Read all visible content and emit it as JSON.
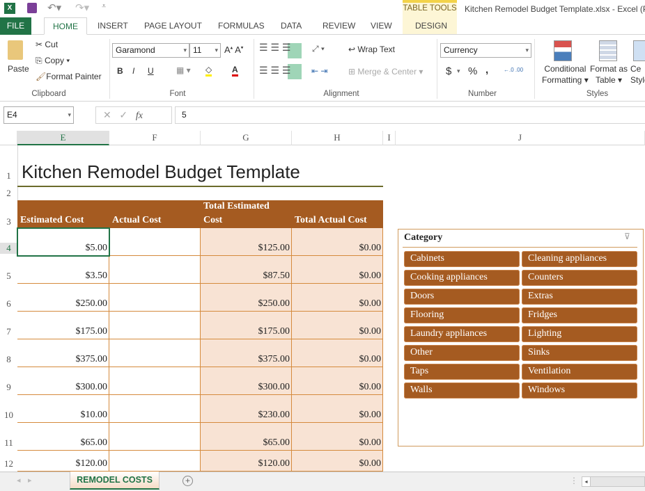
{
  "window": {
    "title": "Kitchen Remodel Budget Template.xlsx - Excel (Pr",
    "contextual_group": "TABLE TOOLS"
  },
  "tabs": [
    "FILE",
    "HOME",
    "INSERT",
    "PAGE LAYOUT",
    "FORMULAS",
    "DATA",
    "REVIEW",
    "VIEW",
    "DESIGN"
  ],
  "ribbon": {
    "clipboard": {
      "paste": "Paste",
      "cut": "Cut",
      "copy": "Copy",
      "format_painter": "Format Painter",
      "label": "Clipboard"
    },
    "font": {
      "name": "Garamond",
      "size": "11",
      "bold": "B",
      "italic": "I",
      "underline": "U",
      "label": "Font"
    },
    "alignment": {
      "wrap": "Wrap Text",
      "merge": "Merge & Center",
      "label": "Alignment"
    },
    "number": {
      "format": "Currency",
      "dollar": "$",
      "percent": "%",
      "comma": ",",
      "label": "Number"
    },
    "styles": {
      "conditional": "Conditional",
      "conditional2": "Formatting",
      "format_table": "Format as",
      "format_table2": "Table",
      "cell_styles": "Ce",
      "cell_styles2": "Style",
      "label": "Styles"
    }
  },
  "formula_bar": {
    "name_box": "E4",
    "fx": "fx",
    "value": "5"
  },
  "columns": [
    "E",
    "F",
    "G",
    "H",
    "I",
    "J"
  ],
  "sheet": {
    "title": "Kitchen Remodel Budget Template",
    "headers": [
      "Estimated Cost",
      "Actual Cost",
      "Total Estimated Cost",
      "Total Actual Cost"
    ],
    "rows": [
      {
        "n": "4",
        "e": "$5.00",
        "f": "",
        "g": "$125.00",
        "h": "$0.00"
      },
      {
        "n": "5",
        "e": "$3.50",
        "f": "",
        "g": "$87.50",
        "h": "$0.00"
      },
      {
        "n": "6",
        "e": "$250.00",
        "f": "",
        "g": "$250.00",
        "h": "$0.00"
      },
      {
        "n": "7",
        "e": "$175.00",
        "f": "",
        "g": "$175.00",
        "h": "$0.00"
      },
      {
        "n": "8",
        "e": "$375.00",
        "f": "",
        "g": "$375.00",
        "h": "$0.00"
      },
      {
        "n": "9",
        "e": "$300.00",
        "f": "",
        "g": "$300.00",
        "h": "$0.00"
      },
      {
        "n": "10",
        "e": "$10.00",
        "f": "",
        "g": "$230.00",
        "h": "$0.00"
      },
      {
        "n": "11",
        "e": "$65.00",
        "f": "",
        "g": "$65.00",
        "h": "$0.00"
      },
      {
        "n": "12",
        "e": "$120.00",
        "f": "",
        "g": "$120.00",
        "h": "$0.00"
      }
    ]
  },
  "slicer": {
    "title": "Category",
    "items": [
      "Cabinets",
      "Cleaning appliances",
      "Cooking appliances",
      "Counters",
      "Doors",
      "Extras",
      "Flooring",
      "Fridges",
      "Laundry appliances",
      "Lighting",
      "Other",
      "Sinks",
      "Taps",
      "Ventilation",
      "Walls",
      "Windows"
    ]
  },
  "sheet_tabs": [
    "REMODEL COSTS"
  ],
  "colors": {
    "accent": "#217346",
    "header": "#a55b21",
    "shade": "#f8e3d4"
  }
}
